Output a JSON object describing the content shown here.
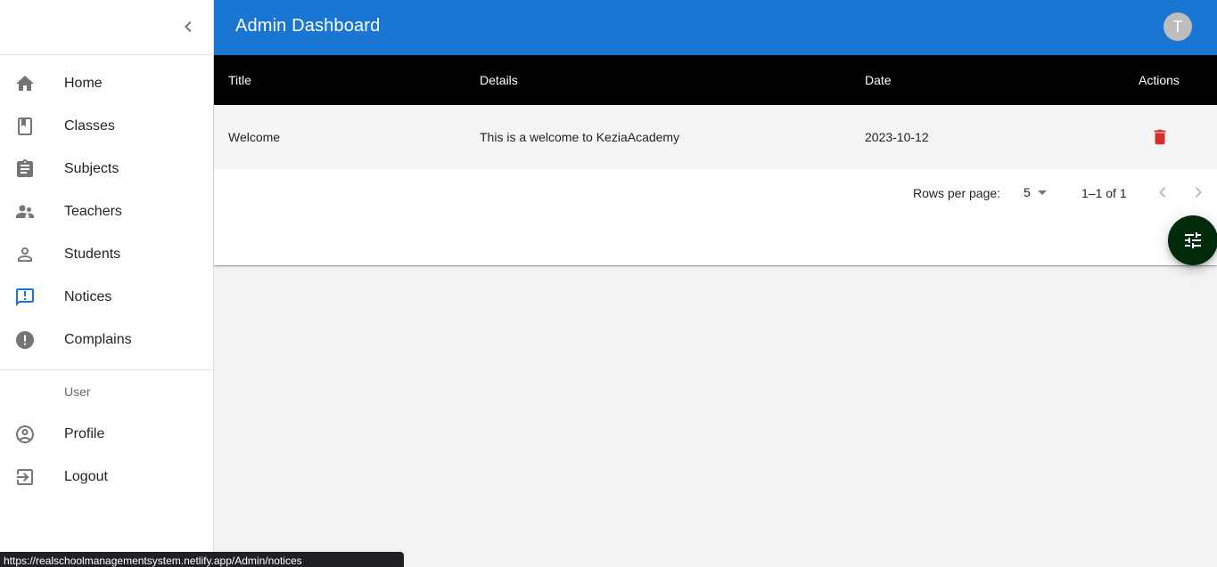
{
  "app": {
    "title": "Admin Dashboard",
    "avatar_initial": "T"
  },
  "sidebar": {
    "items": [
      {
        "label": "Home",
        "icon": "home-icon"
      },
      {
        "label": "Classes",
        "icon": "class-icon"
      },
      {
        "label": "Subjects",
        "icon": "assignment-icon"
      },
      {
        "label": "Teachers",
        "icon": "supervisor-icon"
      },
      {
        "label": "Students",
        "icon": "person-outline-icon"
      },
      {
        "label": "Notices",
        "icon": "announcement-icon",
        "active": true
      },
      {
        "label": "Complains",
        "icon": "report-icon"
      }
    ],
    "section_header": "User",
    "user_items": [
      {
        "label": "Profile",
        "icon": "account-circle-icon"
      },
      {
        "label": "Logout",
        "icon": "logout-icon"
      }
    ]
  },
  "table": {
    "headers": [
      "Title",
      "Details",
      "Date",
      "Actions"
    ],
    "rows": [
      {
        "title": "Welcome",
        "details": "This is a welcome to KeziaAcademy",
        "date": "2023-10-12"
      }
    ]
  },
  "pagination": {
    "rows_per_page_label": "Rows per page:",
    "rows_per_page": "5",
    "range": "1–1 of 1"
  },
  "status_url": "https://realschoolmanagementsystem.netlify.app/Admin/notices",
  "colors": {
    "primary": "#1976d2",
    "header": "#000000",
    "delete": "#d32f2f",
    "fab": "#002b0a",
    "active_icon": "#1976d2"
  }
}
